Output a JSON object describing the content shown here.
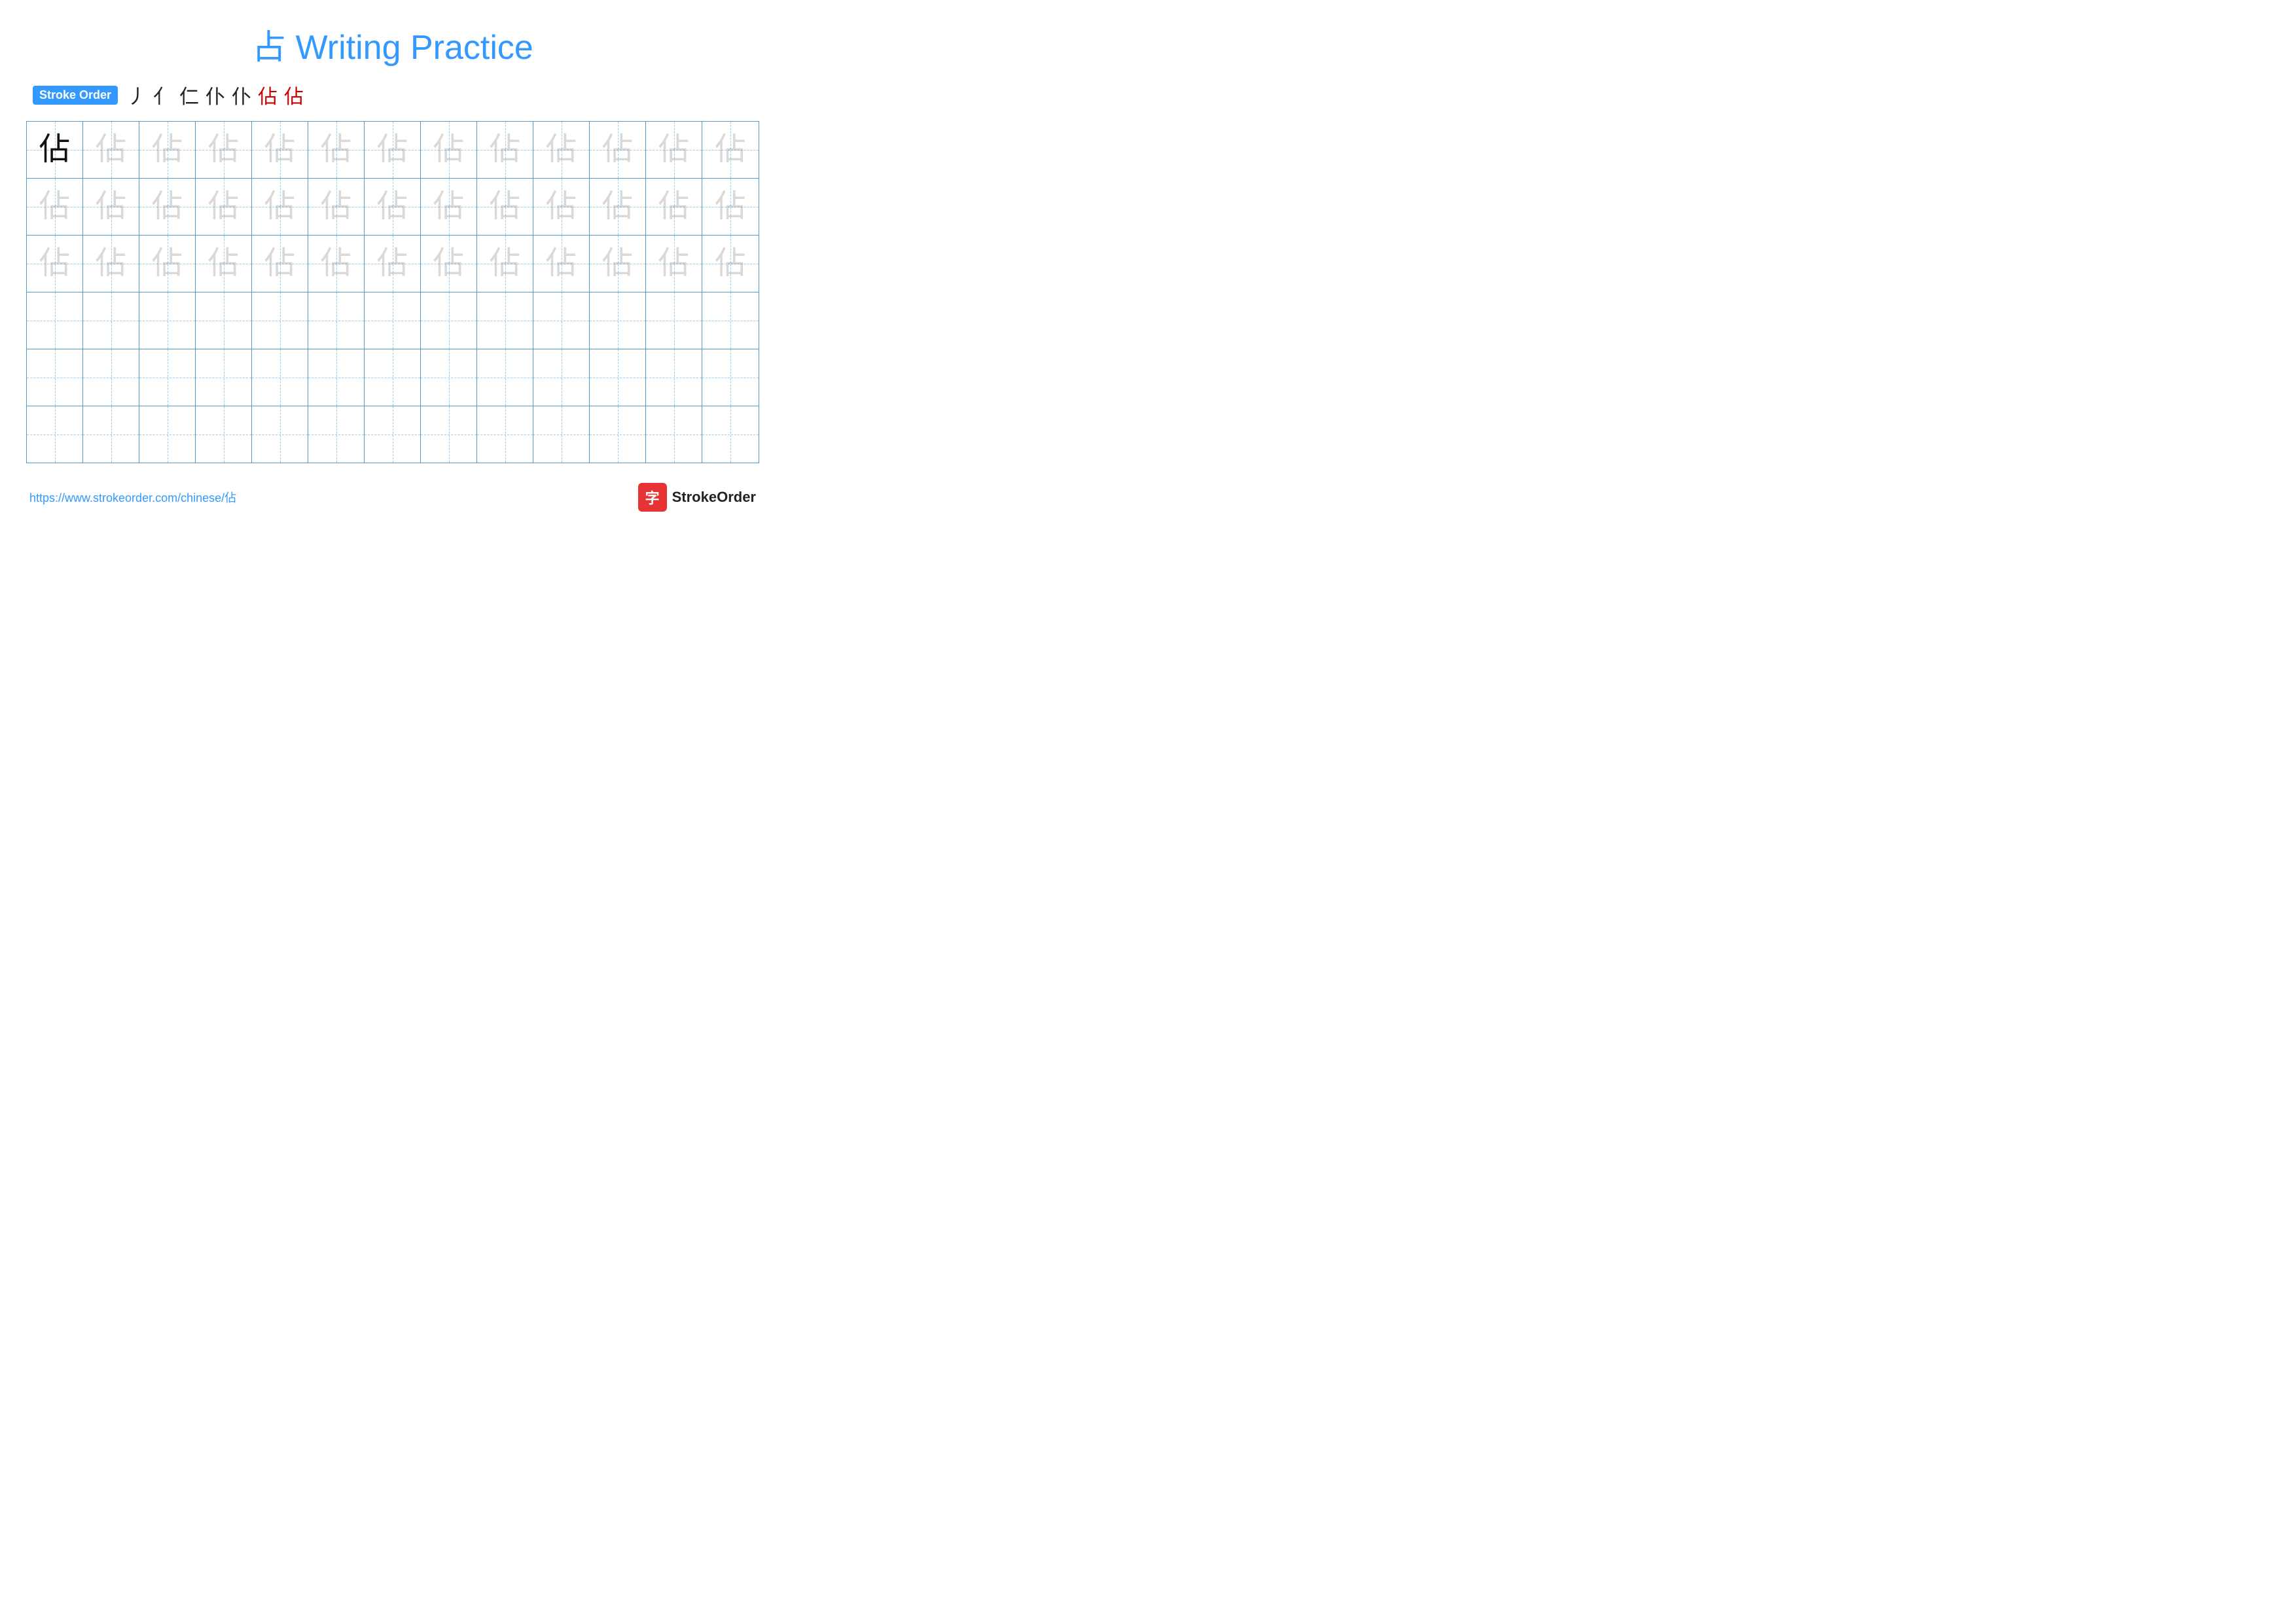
{
  "title": "占 Writing Practice",
  "stroke_order_badge": "Stroke Order",
  "stroke_sequence": [
    "丿",
    "亻",
    "亻|",
    "亻卜",
    "亻卜",
    "佔",
    "佔"
  ],
  "character": "佔",
  "footer_url": "https://www.strokeorder.com/chinese/佔",
  "footer_logo_text": "StrokeOrder",
  "grid": {
    "cols": 13,
    "rows": 6,
    "row1_first_dark": true,
    "row1_rest_light": true,
    "row2_all_light": true,
    "row3_all_light": true
  }
}
